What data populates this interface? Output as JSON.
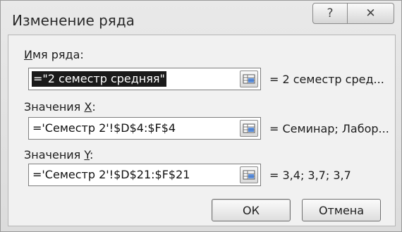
{
  "dialog": {
    "title": "Изменение ряда",
    "help_glyph": "?",
    "close_glyph": "✕"
  },
  "series_name": {
    "label_underlined": "И",
    "label_rest": "мя ряда:",
    "value": "=\"2 семестр средняя\"",
    "preview": "= 2 семестр сред..."
  },
  "x_values": {
    "label_start": "Значения ",
    "label_underlined": "X",
    "label_end": ":",
    "value": "='Семестр 2'!$D$4:$F$4",
    "preview": "= Семинар; Лабор..."
  },
  "y_values": {
    "label_start": "Значения ",
    "label_underlined": "Y",
    "label_end": ":",
    "value": "='Семестр 2'!$D$21:$F$21",
    "preview": "= 3,4; 3,7; 3,7"
  },
  "buttons": {
    "ok": "ОК",
    "cancel": "Отмена"
  }
}
